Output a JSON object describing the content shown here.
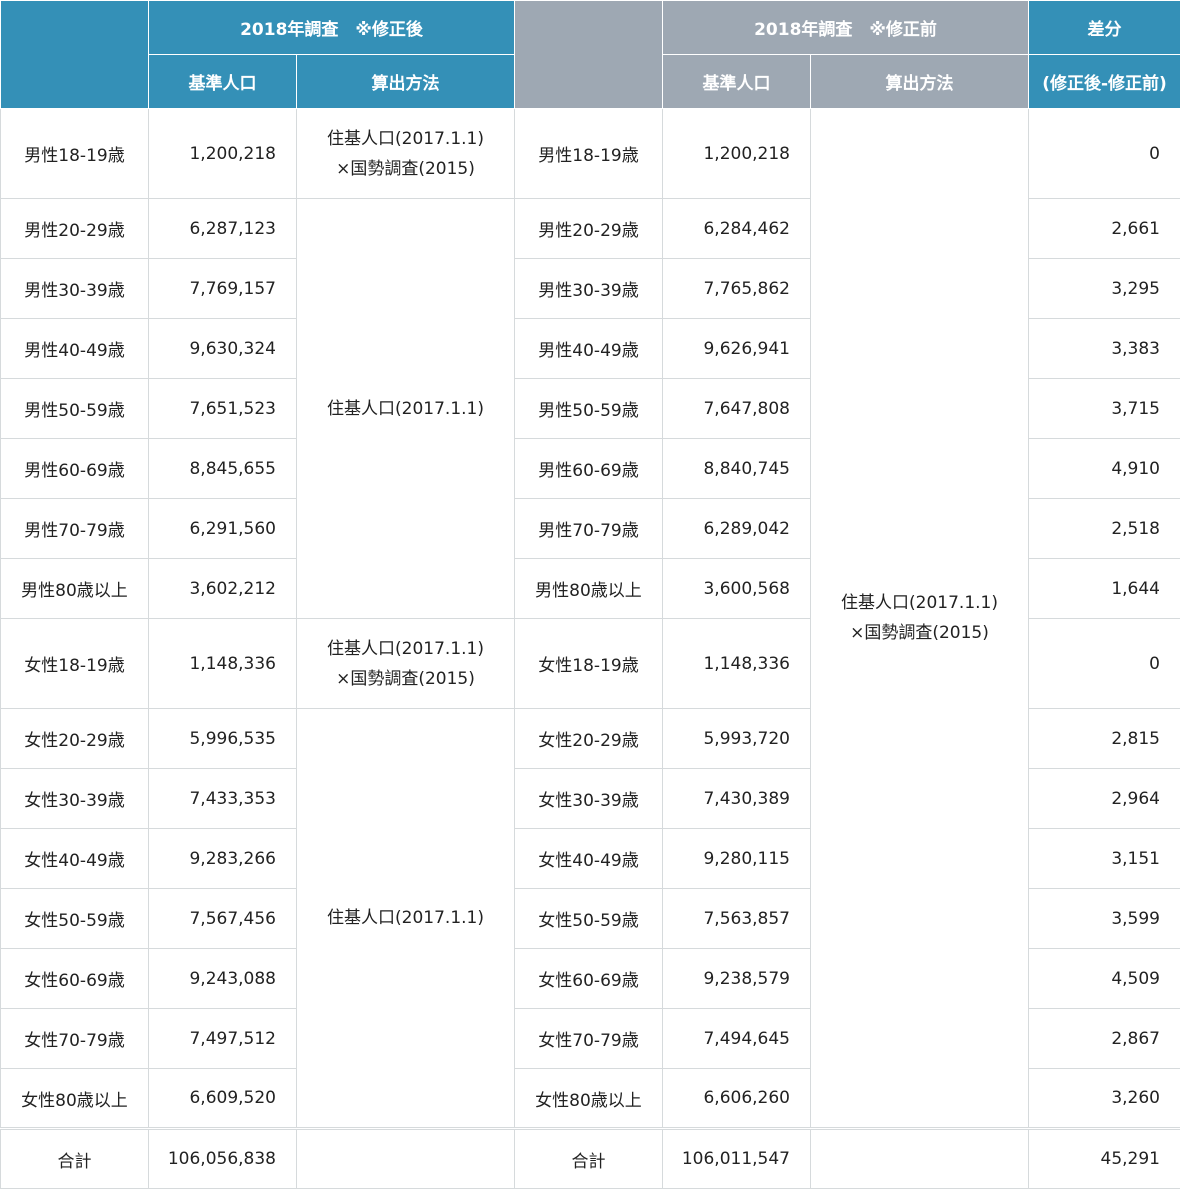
{
  "header": {
    "after_title": "2018年調査　※修正後",
    "before_title": "2018年調査　※修正前",
    "diff_title": "差分",
    "diff_sub": "(修正後-修正前)",
    "base_pop": "基準人口",
    "method": "算出方法"
  },
  "methods": {
    "combined_line1": "住基人口(2017.1.1)",
    "combined_line2": "×国勢調査(2015)",
    "juki_only": "住基人口(2017.1.1)"
  },
  "rows": [
    {
      "label": "男性18-19歳",
      "after": "1,200,218",
      "before": "1,200,218",
      "diff": "0"
    },
    {
      "label": "男性20-29歳",
      "after": "6,287,123",
      "before": "6,284,462",
      "diff": "2,661"
    },
    {
      "label": "男性30-39歳",
      "after": "7,769,157",
      "before": "7,765,862",
      "diff": "3,295"
    },
    {
      "label": "男性40-49歳",
      "after": "9,630,324",
      "before": "9,626,941",
      "diff": "3,383"
    },
    {
      "label": "男性50-59歳",
      "after": "7,651,523",
      "before": "7,647,808",
      "diff": "3,715"
    },
    {
      "label": "男性60-69歳",
      "after": "8,845,655",
      "before": "8,840,745",
      "diff": "4,910"
    },
    {
      "label": "男性70-79歳",
      "after": "6,291,560",
      "before": "6,289,042",
      "diff": "2,518"
    },
    {
      "label": "男性80歳以上",
      "after": "3,602,212",
      "before": "3,600,568",
      "diff": "1,644"
    },
    {
      "label": "女性18-19歳",
      "after": "1,148,336",
      "before": "1,148,336",
      "diff": "0"
    },
    {
      "label": "女性20-29歳",
      "after": "5,996,535",
      "before": "5,993,720",
      "diff": "2,815"
    },
    {
      "label": "女性30-39歳",
      "after": "7,433,353",
      "before": "7,430,389",
      "diff": "2,964"
    },
    {
      "label": "女性40-49歳",
      "after": "9,283,266",
      "before": "9,280,115",
      "diff": "3,151"
    },
    {
      "label": "女性50-59歳",
      "after": "7,567,456",
      "before": "7,563,857",
      "diff": "3,599"
    },
    {
      "label": "女性60-69歳",
      "after": "9,243,088",
      "before": "9,238,579",
      "diff": "4,509"
    },
    {
      "label": "女性70-79歳",
      "after": "7,497,512",
      "before": "7,494,645",
      "diff": "2,867"
    },
    {
      "label": "女性80歳以上",
      "after": "6,609,520",
      "before": "6,606,260",
      "diff": "3,260"
    }
  ],
  "total": {
    "label": "合計",
    "after": "106,056,838",
    "before": "106,011,547",
    "diff": "45,291"
  }
}
